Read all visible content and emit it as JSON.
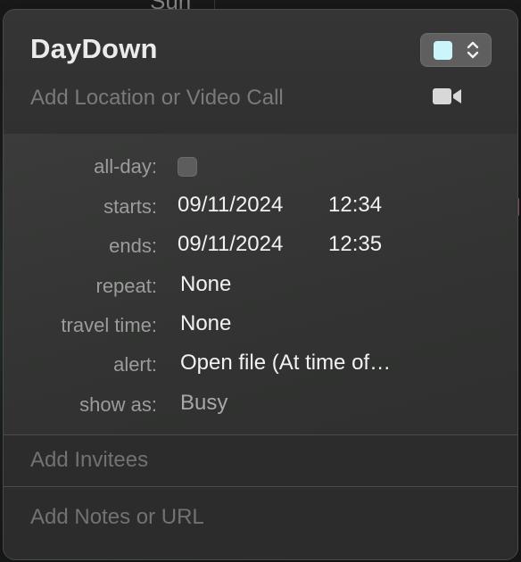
{
  "background": {
    "day_label": "Sun"
  },
  "event": {
    "title": "DayDown",
    "color": "#c9f5fb",
    "location_placeholder": "Add Location or Video Call",
    "video_icon": "video-camera-icon"
  },
  "details": {
    "allday_label": "all-day:",
    "allday_checked": false,
    "starts_label": "starts:",
    "starts_date": "09/11/2024",
    "starts_time": "12:34",
    "ends_label": "ends:",
    "ends_date": "09/11/2024",
    "ends_time": "12:35",
    "repeat_label": "repeat:",
    "repeat_value": "None",
    "travel_label": "travel time:",
    "travel_value": "None",
    "alert_label": "alert:",
    "alert_value": "Open file (At time of…",
    "showas_label": "show as:",
    "showas_value": "Busy"
  },
  "invitees": {
    "placeholder": "Add Invitees"
  },
  "notes": {
    "placeholder": "Add Notes or URL"
  }
}
